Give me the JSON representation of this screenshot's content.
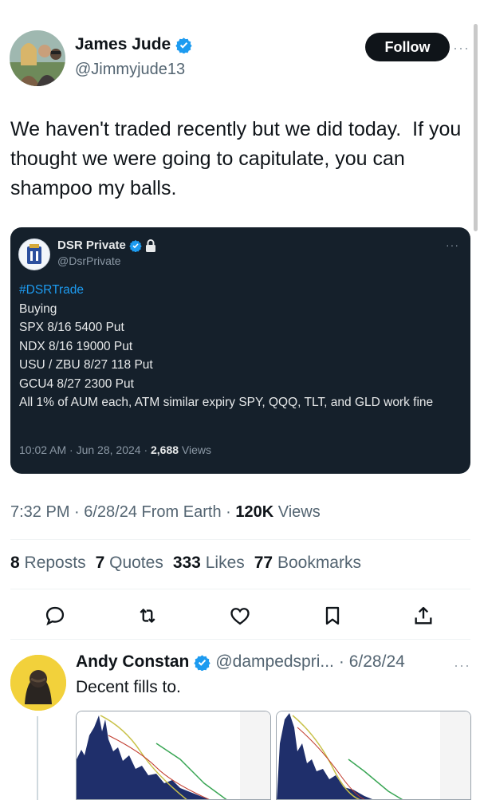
{
  "author": {
    "name": "James Jude",
    "handle": "@Jimmyjude13",
    "follow_label": "Follow",
    "more_label": "···"
  },
  "tweet": {
    "text": "We haven't traded recently but we did today.  If you thought we were going to capitulate, you can shampoo my balls."
  },
  "quoted": {
    "name": "DSR Private",
    "handle": "@DsrPrivate",
    "more_label": "···",
    "hashtag": "#DSRTrade",
    "lines": [
      "Buying",
      "SPX 8/16 5400 Put",
      "NDX 8/16 19000 Put",
      "USU / ZBU 8/27 118 Put",
      "GCU4 8/27 2300 Put",
      "All 1% of AUM each,  ATM similar expiry SPY, QQQ, TLT, and GLD work fine"
    ],
    "timestamp": "10:02 AM · Jun 28, 2024 · ",
    "views_count": "2,688",
    "views_label": " Views"
  },
  "meta": {
    "time": "7:32 PM · 6/28/24 From Earth · ",
    "views_count": "120K",
    "views_label": " Views"
  },
  "stats": {
    "reposts_count": "8",
    "reposts_label": "Reposts",
    "quotes_count": "7",
    "quotes_label": "Quotes",
    "likes_count": "333",
    "likes_label": "Likes",
    "bookmarks_count": "77",
    "bookmarks_label": "Bookmarks"
  },
  "actions": [
    "reply-icon",
    "retweet-icon",
    "like-icon",
    "bookmark-icon",
    "share-icon"
  ],
  "reply": {
    "name": "Andy Constan",
    "handle": "@dampedspri...",
    "date": "· 6/28/24",
    "more_label": "···",
    "text": "Decent fills to."
  },
  "colors": {
    "verified": "#1d9bf0",
    "quote_bg": "#15202b",
    "text_secondary": "#536471"
  }
}
